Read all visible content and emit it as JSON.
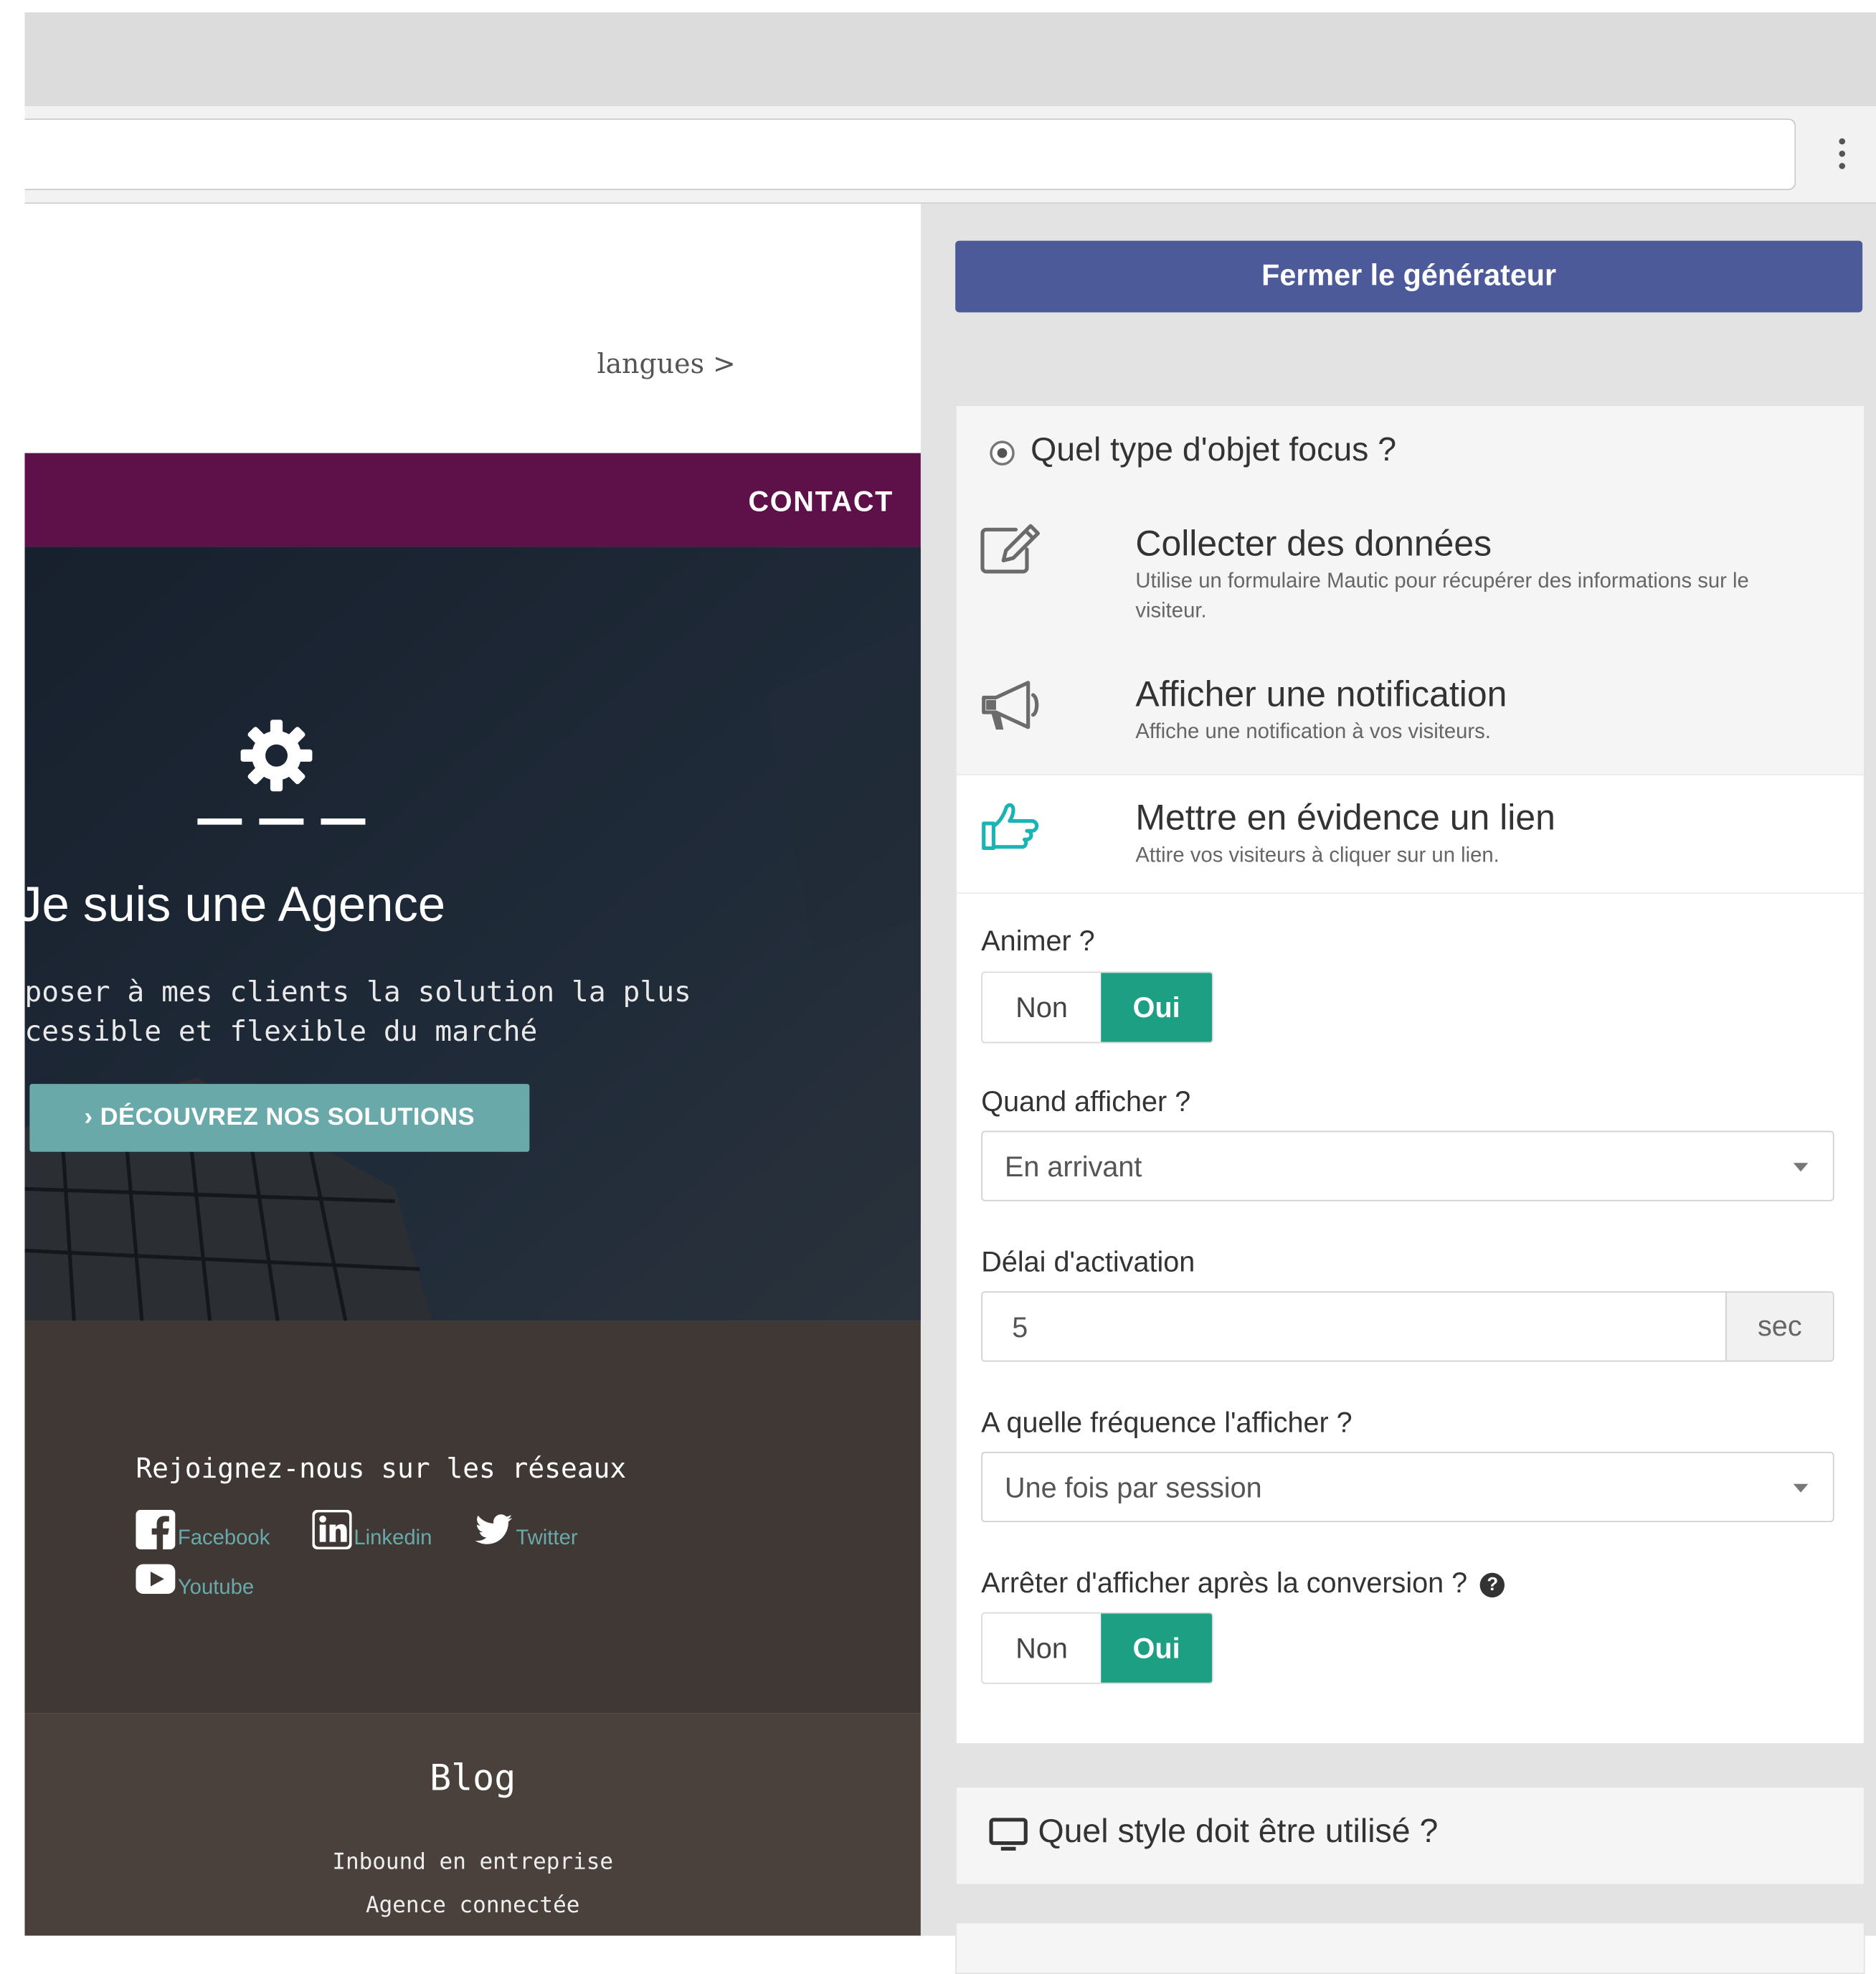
{
  "preview": {
    "languages_link": "langues >",
    "nav_contact": "CONTACT",
    "hero_title": "Je suis une Agence",
    "hero_text_line1": "poser à mes clients la solution la plus",
    "hero_text_line2": "cessible et flexible du marché",
    "hero_button": "› DÉCOUVREZ NOS SOLUTIONS",
    "social_title": "Rejoignez-nous sur les réseaux",
    "social_links": [
      {
        "label": "Facebook",
        "icon": "facebook-icon"
      },
      {
        "label": "Linkedin",
        "icon": "linkedin-icon"
      },
      {
        "label": "Twitter",
        "icon": "twitter-icon"
      },
      {
        "label": "Youtube",
        "icon": "youtube-icon"
      }
    ],
    "blog_title": "Blog",
    "blog_links": [
      "Inbound en entreprise",
      "Agence connectée"
    ]
  },
  "builder": {
    "close_button": "Fermer le générateur",
    "type_section_title": "Quel type d'objet focus ?",
    "types": [
      {
        "name": "Collecter des données",
        "desc": "Utilise un formulaire Mautic pour récupérer des informations sur le visiteur.",
        "icon": "edit-icon"
      },
      {
        "name": "Afficher une notification",
        "desc": "Affiche une notification à vos visiteurs.",
        "icon": "megaphone-icon"
      },
      {
        "name": "Mettre en évidence un lien",
        "desc": "Attire vos visiteurs à cliquer sur un lien.",
        "icon": "pointing-hand-icon"
      }
    ],
    "animate_label": "Animer ?",
    "animate_toggle": {
      "off": "Non",
      "on": "Oui",
      "selected": "Oui"
    },
    "when_label": "Quand afficher ?",
    "when_value": "En arrivant",
    "delay_label": "Délai d'activation",
    "delay_value": "5",
    "delay_unit": "sec",
    "frequency_label": "A quelle fréquence l'afficher ?",
    "frequency_value": "Une fois par session",
    "stop_label": "Arrêter d'afficher après la conversion ?",
    "stop_toggle": {
      "off": "Non",
      "on": "Oui",
      "selected": "Oui"
    },
    "style_section_title": "Quel style doit être utilisé ?"
  },
  "colors": {
    "accent": "#1d9f84",
    "close_button": "#4d5a9a",
    "nav": "#5e1049",
    "hero_button": "#6aa9aa"
  }
}
